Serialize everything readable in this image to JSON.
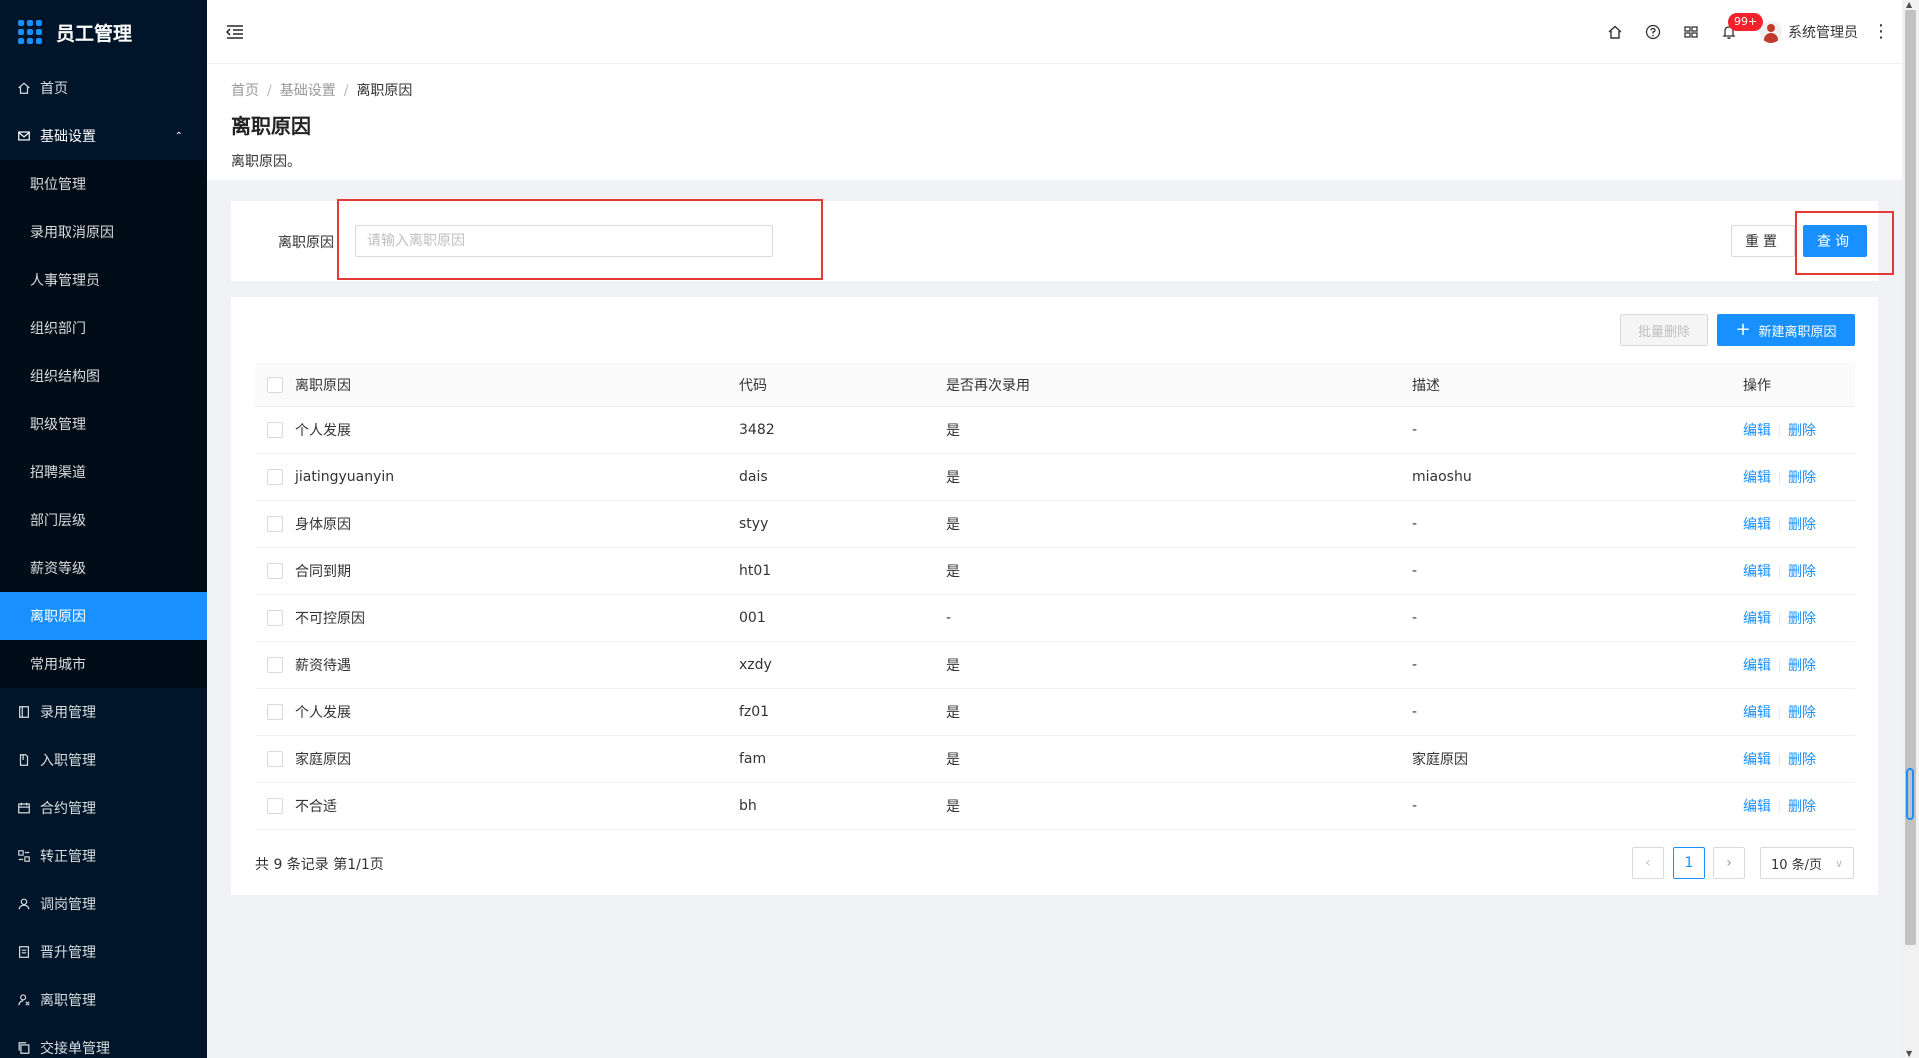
{
  "app": {
    "title": "员工管理"
  },
  "sidebar": {
    "items": [
      {
        "label": "首页",
        "icon": "home-icon"
      },
      {
        "label": "基础设置",
        "icon": "mail-icon",
        "expanded": true,
        "children": [
          {
            "label": "职位管理"
          },
          {
            "label": "录用取消原因"
          },
          {
            "label": "人事管理员"
          },
          {
            "label": "组织部门"
          },
          {
            "label": "组织结构图"
          },
          {
            "label": "职级管理"
          },
          {
            "label": "招聘渠道"
          },
          {
            "label": "部门层级"
          },
          {
            "label": "薪资等级"
          },
          {
            "label": "离职原因",
            "active": true
          },
          {
            "label": "常用城市"
          }
        ]
      },
      {
        "label": "录用管理",
        "icon": "book-icon"
      },
      {
        "label": "入职管理",
        "icon": "file-icon"
      },
      {
        "label": "合约管理",
        "icon": "calendar-icon"
      },
      {
        "label": "转正管理",
        "icon": "swap-icon"
      },
      {
        "label": "调岗管理",
        "icon": "user-icon"
      },
      {
        "label": "晋升管理",
        "icon": "doc-icon"
      },
      {
        "label": "离职管理",
        "icon": "user-leave-icon"
      },
      {
        "label": "交接单管理",
        "icon": "copy-icon"
      }
    ]
  },
  "header": {
    "badge": "99+",
    "user_name": "系统管理员",
    "more": "⋮"
  },
  "breadcrumb": {
    "home": "首页",
    "parent": "基础设置",
    "current": "离职原因",
    "separator": "/"
  },
  "page": {
    "title": "离职原因",
    "description": "离职原因。"
  },
  "search": {
    "label": "离职原因",
    "placeholder": "请输入离职原因",
    "value": "",
    "reset_label": "重置",
    "query_label": "查询"
  },
  "toolbar": {
    "batch_delete_label": "批量删除",
    "new_label": "新建离职原因",
    "new_icon": "+"
  },
  "table": {
    "columns": {
      "reason": "离职原因",
      "code": "代码",
      "rehire": "是否再次录用",
      "desc": "描述",
      "op": "操作"
    },
    "edit_label": "编辑",
    "delete_label": "删除",
    "rows": [
      {
        "reason": "个人发展",
        "code": "3482",
        "rehire": "是",
        "desc": "-"
      },
      {
        "reason": "jiatingyuanyin",
        "code": "dais",
        "rehire": "是",
        "desc": "miaoshu"
      },
      {
        "reason": "身体原因",
        "code": "styy",
        "rehire": "是",
        "desc": "-"
      },
      {
        "reason": "合同到期",
        "code": "ht01",
        "rehire": "是",
        "desc": "-"
      },
      {
        "reason": "不可控原因",
        "code": "001",
        "rehire": "-",
        "desc": "-"
      },
      {
        "reason": "薪资待遇",
        "code": "xzdy",
        "rehire": "是",
        "desc": "-"
      },
      {
        "reason": "个人发展",
        "code": "fz01",
        "rehire": "是",
        "desc": "-"
      },
      {
        "reason": "家庭原因",
        "code": "fam",
        "rehire": "是",
        "desc": "家庭原因"
      },
      {
        "reason": "不合适",
        "code": "bh",
        "rehire": "是",
        "desc": "-"
      }
    ]
  },
  "pagination": {
    "summary": "共 9 条记录 第1/1页",
    "current_page": "1",
    "prev": "‹",
    "next": "›",
    "page_size": "10 条/页",
    "dropdown": "∨"
  },
  "colors": {
    "primary": "#1890ff",
    "sidebar_bg": "#001529",
    "highlight_box": "#e53935",
    "badge": "#f5222d"
  }
}
